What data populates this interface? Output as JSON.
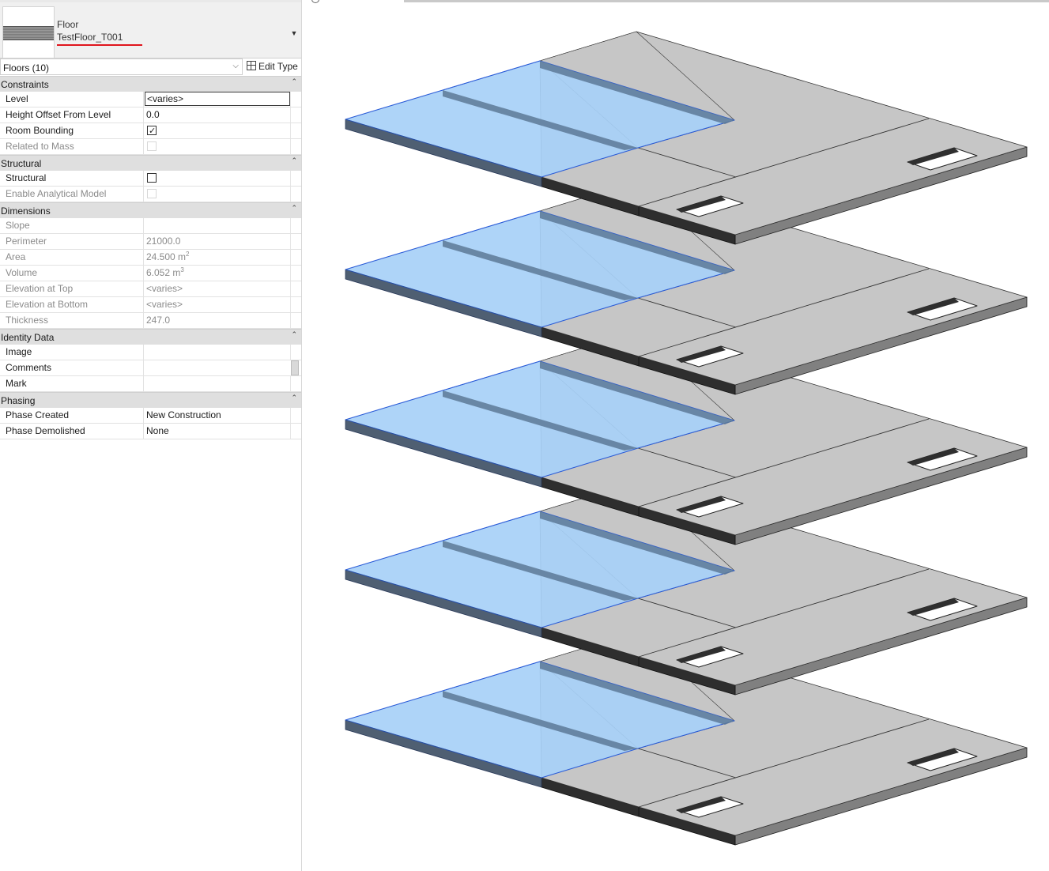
{
  "type_selector": {
    "family": "Floor",
    "type_name": "TestFloor_T001",
    "dropdown_icon": "caret-down-icon"
  },
  "filter": {
    "label": "Floors (10)",
    "edit_type_label": "Edit Type"
  },
  "sections": {
    "constraints": {
      "title": "Constraints",
      "level": {
        "name": "Level",
        "value": "<varies>"
      },
      "height_offset": {
        "name": "Height Offset From Level",
        "value": "0.0"
      },
      "room_bounding": {
        "name": "Room Bounding",
        "checked": true
      },
      "related_mass": {
        "name": "Related to Mass",
        "checked": false
      }
    },
    "structural": {
      "title": "Structural",
      "structural": {
        "name": "Structural",
        "checked": false
      },
      "analytical": {
        "name": "Enable Analytical Model",
        "checked": false
      }
    },
    "dimensions": {
      "title": "Dimensions",
      "slope": {
        "name": "Slope",
        "value": ""
      },
      "perimeter": {
        "name": "Perimeter",
        "value": "21000.0"
      },
      "area": {
        "name": "Area",
        "value": "24.500 m",
        "unit_sup": "2"
      },
      "volume": {
        "name": "Volume",
        "value": "6.052 m",
        "unit_sup": "3"
      },
      "elev_top": {
        "name": "Elevation at Top",
        "value": "<varies>"
      },
      "elev_bottom": {
        "name": "Elevation at Bottom",
        "value": "<varies>"
      },
      "thickness": {
        "name": "Thickness",
        "value": "247.0"
      }
    },
    "identity": {
      "title": "Identity Data",
      "image": {
        "name": "Image",
        "value": ""
      },
      "comments": {
        "name": "Comments",
        "value": ""
      },
      "mark": {
        "name": "Mark",
        "value": ""
      }
    },
    "phasing": {
      "title": "Phasing",
      "phase_created": {
        "name": "Phase Created",
        "value": "New Construction"
      },
      "phase_demolished": {
        "name": "Phase Demolished",
        "value": "None"
      }
    }
  },
  "view": {
    "slab_count": 5,
    "colors": {
      "selected_fill": "#a7d0f7",
      "selected_edge": "#2a5bd7",
      "slab_top": "#c6c6c6",
      "slab_side_light": "#808080",
      "slab_side_dark": "#2e2e2e"
    }
  }
}
